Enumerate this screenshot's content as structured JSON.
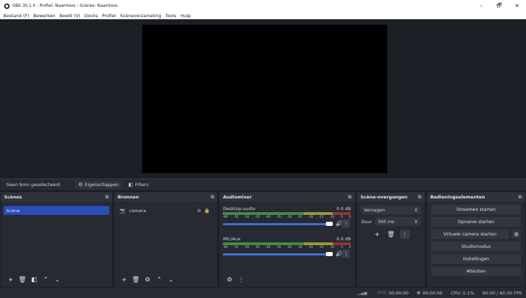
{
  "window": {
    "title": "OBS 30.1.0 - Profiel: Naamloos - Scènes: Naamloos",
    "controls": [
      "–",
      "🗗",
      "✕"
    ]
  },
  "menu": [
    "Bestand (F)",
    "Bewerken",
    "Beeld (V)",
    "Docks",
    "Profiel",
    "Scèneverzameling",
    "Tools",
    "Hulp"
  ],
  "source_toolbar": {
    "no_source": "Geen bron geselecteerd",
    "properties": "Eigenschappen",
    "filters": "Filters"
  },
  "scenes": {
    "title": "Scènes",
    "items": [
      "Scène"
    ]
  },
  "sources": {
    "title": "Bronnen",
    "items": [
      "camera"
    ]
  },
  "audio_mixer": {
    "title": "Audiomixer",
    "scale": [
      "-60",
      "-55",
      "-50",
      "-45",
      "-40",
      "-35",
      "-30",
      "-25",
      "-20",
      "-15",
      "-10",
      "-5",
      "0"
    ],
    "channels": [
      {
        "name": "Desktop-audio",
        "db": "0.0 dB",
        "volume": 1.0
      },
      {
        "name": "Mic/Aux",
        "db": "0.0 dB",
        "volume": 1.0
      }
    ]
  },
  "transitions": {
    "title": "Scène-overgangen",
    "selected": "Vervagen",
    "duration_label": "Duur",
    "duration_value": "300 ms"
  },
  "controls": {
    "title": "Bedieningselementen",
    "buttons": [
      "Streamen starten",
      "Opname starten",
      "Virtuele camera starten",
      "Studiomodus",
      "Instellingen",
      "Afsluiten"
    ]
  },
  "status": {
    "stream_time": "00:00:00",
    "rec_time": "00:00:00",
    "cpu": "CPU: 0.1%",
    "fps": "60.00 / 60.00 FPS"
  },
  "colors": {
    "selection": "#284cb8",
    "slider": "#3d74d9",
    "background": "#1d1f26",
    "panel": "#272a33"
  }
}
